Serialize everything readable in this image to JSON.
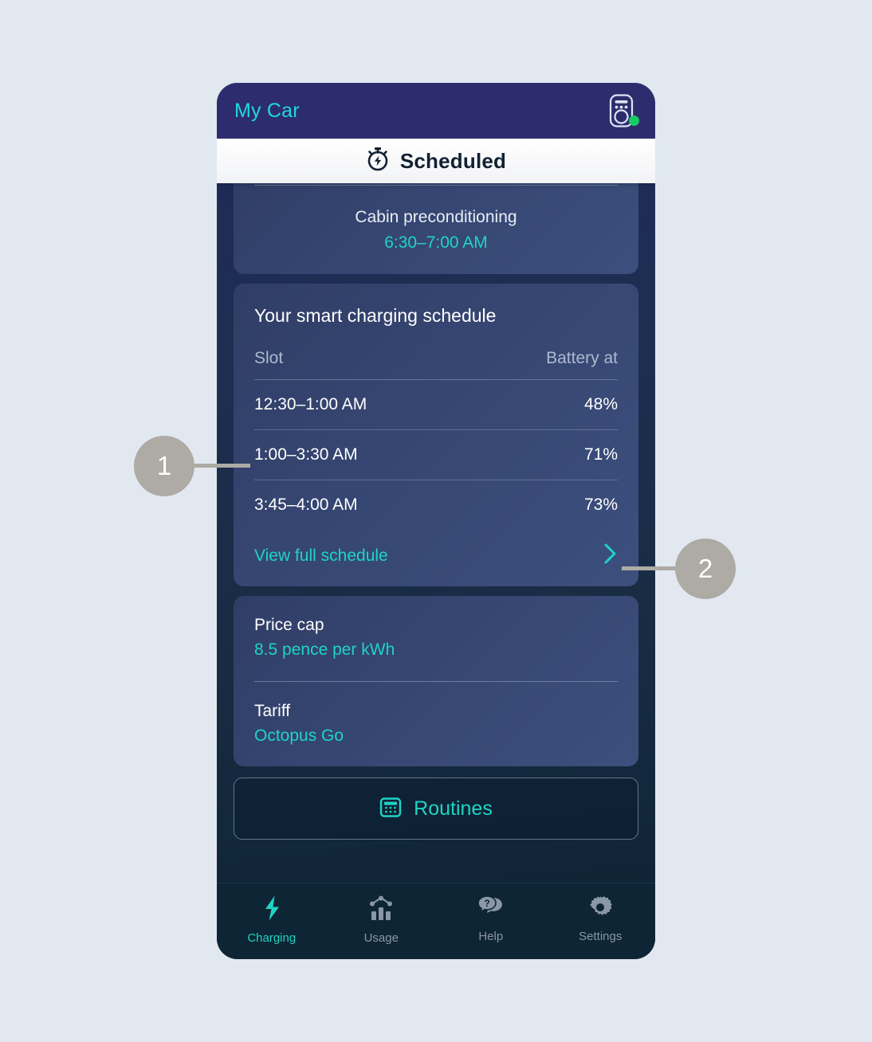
{
  "header": {
    "title": "My Car",
    "charger_icon": "ev-charger-icon",
    "status_dot_color": "#18c964"
  },
  "tab_bar": {
    "icon": "stopwatch-bolt-icon",
    "label": "Scheduled"
  },
  "preconditioning_card": {
    "title": "Cabin preconditioning",
    "time_range": "6:30–7:00 AM"
  },
  "schedule_card": {
    "heading": "Your smart charging schedule",
    "columns": [
      "Slot",
      "Battery at"
    ],
    "rows": [
      {
        "slot": "12:30–1:00 AM",
        "battery": "48%"
      },
      {
        "slot": "1:00–3:30 AM",
        "battery": "71%"
      },
      {
        "slot": "3:45–4:00 AM",
        "battery": "73%"
      }
    ],
    "view_full_label": "View full schedule",
    "chevron_icon": "chevron-right-icon"
  },
  "tariff_card": {
    "price_cap_label": "Price cap",
    "price_cap_value": "8.5 pence per kWh",
    "tariff_label": "Tariff",
    "tariff_value": "Octopus Go"
  },
  "routines_button": {
    "icon": "calendar-icon",
    "label": "Routines"
  },
  "bottom_nav": {
    "items": [
      {
        "icon": "lightning-bolt-icon",
        "label": "Charging",
        "active": true
      },
      {
        "icon": "bar-chart-icon",
        "label": "Usage",
        "active": false
      },
      {
        "icon": "help-chat-icon",
        "label": "Help",
        "active": false
      },
      {
        "icon": "gear-icon",
        "label": "Settings",
        "active": false
      }
    ]
  },
  "callouts": [
    {
      "number": "1"
    },
    {
      "number": "2"
    }
  ],
  "colors": {
    "accent_teal": "#1fd4c4",
    "header_cyan": "#22d9d9",
    "header_bg": "#2d2d6e",
    "page_bg": "#e1e8f0",
    "callout_grey": "#aeaaa4"
  }
}
